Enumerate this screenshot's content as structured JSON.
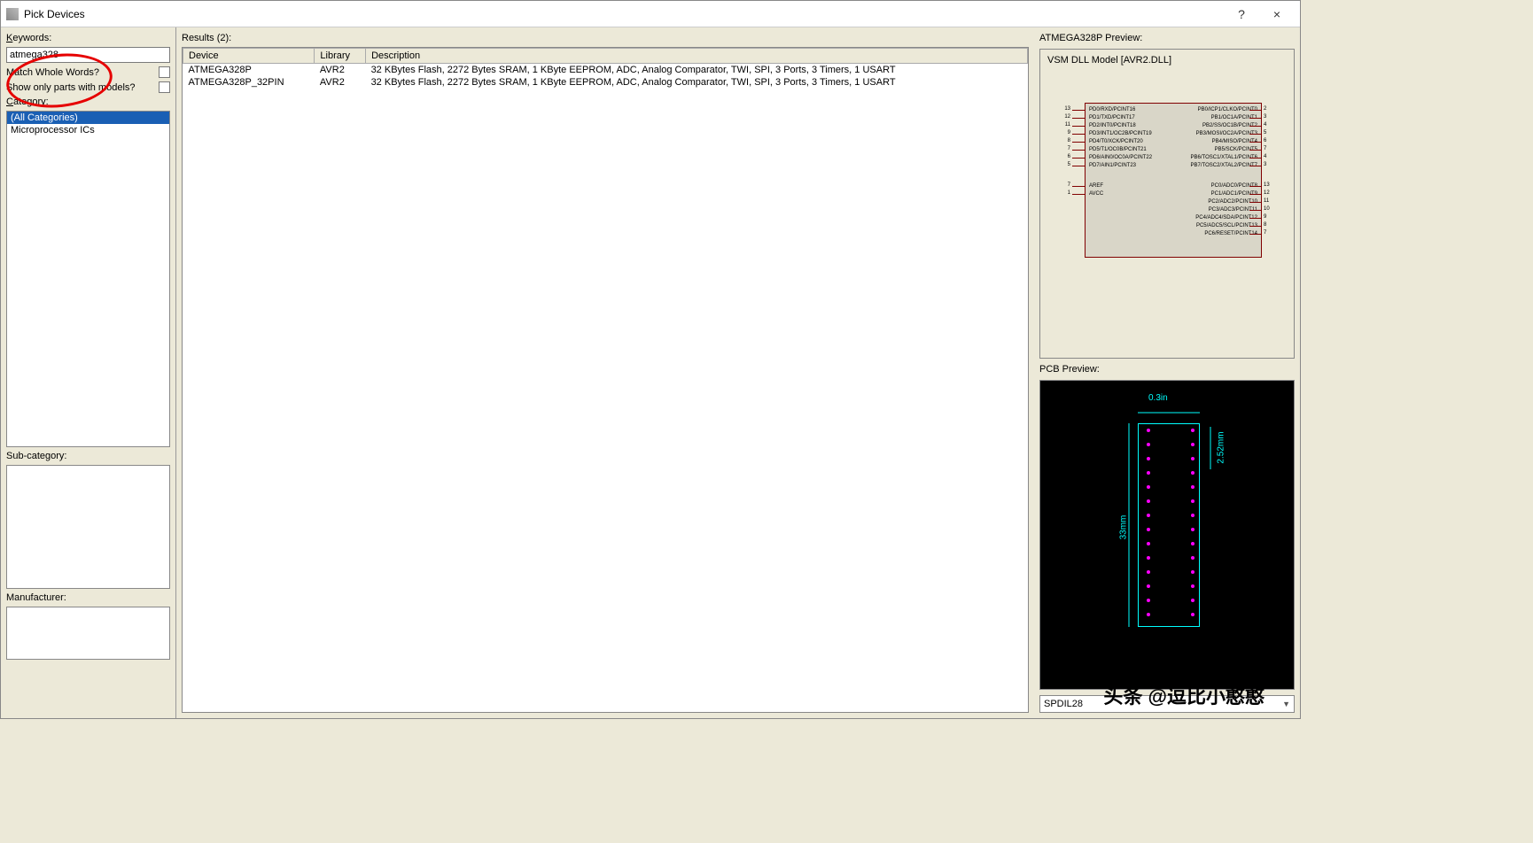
{
  "title": "Pick Devices",
  "help": "?",
  "close": "×",
  "left": {
    "keywords_label": "Keywords:",
    "keywords_value": "atmega328",
    "match_whole": "Match Whole Words?",
    "show_models": "Show only parts with models?",
    "category_label": "Category:",
    "categories": [
      "(All Categories)",
      "Microprocessor ICs"
    ],
    "subcategory_label": "Sub-category:",
    "manufacturer_label": "Manufacturer:"
  },
  "results": {
    "label": "Results (2):",
    "headers": [
      "Device",
      "Library",
      "Description"
    ],
    "rows": [
      [
        "ATMEGA328P",
        "AVR2",
        "32 KBytes Flash, 2272 Bytes SRAM, 1 KByte EEPROM, ADC, Analog Comparator, TWI, SPI, 3 Ports, 3 Timers, 1 USART"
      ],
      [
        "ATMEGA328P_32PIN",
        "AVR2",
        "32 KBytes Flash, 2272 Bytes SRAM, 1 KByte EEPROM, ADC, Analog Comparator, TWI, SPI, 3 Ports, 3 Timers, 1 USART"
      ]
    ]
  },
  "preview": {
    "sch_label": "ATMEGA328P Preview:",
    "model": "VSM DLL Model [AVR2.DLL]",
    "pins_left": [
      {
        "n": "13",
        "t": "PD0/RXD/PCINT16"
      },
      {
        "n": "12",
        "t": "PD1/TXD/PCINT17"
      },
      {
        "n": "11",
        "t": "PD2/INT0/PCINT18"
      },
      {
        "n": "9",
        "t": "PD3/INT1/OC2B/PCINT19"
      },
      {
        "n": "8",
        "t": "PD4/T0/XCK/PCINT20"
      },
      {
        "n": "7",
        "t": "PD5/T1/OC0B/PCINT21"
      },
      {
        "n": "6",
        "t": "PD6/AIN0/OC0A/PCINT22"
      },
      {
        "n": "5",
        "t": "PD7/AIN1/PCINT23"
      },
      {
        "n": "7",
        "t": "AREF"
      },
      {
        "n": "1",
        "t": "AVCC"
      }
    ],
    "pins_right": [
      {
        "n": "2",
        "t": "PB0/ICP1/CLKO/PCINT0"
      },
      {
        "n": "3",
        "t": "PB1/OC1A/PCINT1"
      },
      {
        "n": "4",
        "t": "PB2/SS/OC1B/PCINT2"
      },
      {
        "n": "5",
        "t": "PB3/MOSI/OC2A/PCINT3"
      },
      {
        "n": "6",
        "t": "PB4/MISO/PCINT4"
      },
      {
        "n": "7",
        "t": "PB5/SCK/PCINT5"
      },
      {
        "n": "4",
        "t": "PB6/TOSC1/XTAL1/PCINT6"
      },
      {
        "n": "3",
        "t": "PB7/TOSC2/XTAL2/PCINT7"
      },
      {
        "n": "13",
        "t": "PC0/ADC0/PCINT8"
      },
      {
        "n": "12",
        "t": "PC1/ADC1/PCINT9"
      },
      {
        "n": "11",
        "t": "PC2/ADC2/PCINT10"
      },
      {
        "n": "10",
        "t": "PC3/ADC3/PCINT11"
      },
      {
        "n": "9",
        "t": "PC4/ADC4/SDA/PCINT12"
      },
      {
        "n": "8",
        "t": "PC5/ADC5/SCL/PCINT13"
      },
      {
        "n": "7",
        "t": "PC6/RESET/PCINT14"
      }
    ],
    "pcb_label": "PCB Preview:",
    "dim_w": "0.3in",
    "dim_h": "33mm",
    "dim_p": "2.52mm",
    "package": "SPDIL28"
  },
  "watermark": "头条 @逗比小憨憨"
}
